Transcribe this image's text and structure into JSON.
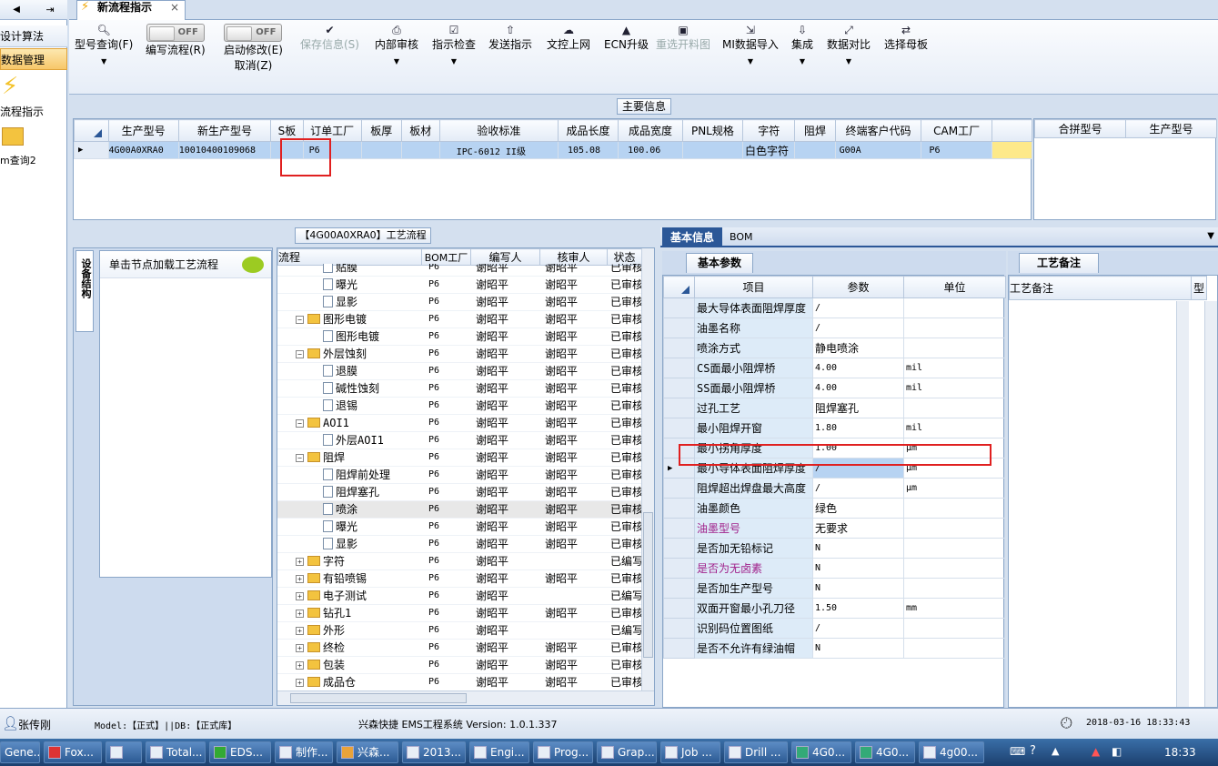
{
  "window": {
    "tab_title": "新流程指示",
    "tab_close": "×"
  },
  "left_nav": {
    "items": [
      {
        "label": "设计算法"
      },
      {
        "label": "数据管理",
        "selected": true
      },
      {
        "label": "流程指示"
      },
      {
        "label": "m查询2"
      }
    ]
  },
  "toolbar": {
    "buttons": [
      {
        "label": "型号查询(F)",
        "icon": "search-icon",
        "dropdown": true
      },
      {
        "label": "编写流程(R)",
        "toggle": "OFF"
      },
      {
        "label": "启动修改(E)",
        "toggle": "OFF",
        "sub": "取消(Z)"
      },
      {
        "label": "保存信息(S)",
        "icon": "check-icon",
        "disabled": true
      },
      {
        "label": "内部审核",
        "icon": "printer-icon",
        "dropdown": true
      },
      {
        "label": "指示检查",
        "icon": "checklist-icon",
        "dropdown": true
      },
      {
        "label": "发送指示",
        "icon": "upload-icon"
      },
      {
        "label": "文控上网",
        "icon": "cloud-icon"
      },
      {
        "label": "ECN升级",
        "icon": "ecn-icon"
      },
      {
        "label": "重选开料图",
        "icon": "image-icon",
        "disabled": true
      },
      {
        "label": "MI数据导入",
        "icon": "import-icon",
        "dropdown": true
      },
      {
        "label": "集成",
        "icon": "download-icon",
        "dropdown": true
      },
      {
        "label": "数据对比",
        "icon": "compare-icon",
        "dropdown": true
      },
      {
        "label": "选择母板",
        "icon": "shuffle-icon"
      }
    ]
  },
  "main_info": {
    "title": "主要信息",
    "columns": [
      "生产型号",
      "新生产型号",
      "S板",
      "订单工厂",
      "板厚",
      "板材",
      "验收标准",
      "成品长度",
      "成品宽度",
      "PNL规格",
      "字符",
      "阻焊",
      "终端客户代码",
      "CAM工厂"
    ],
    "rows": [
      [
        "4G00A0XRA0",
        "10010400109068",
        "",
        "P6",
        "",
        "",
        "IPC-6012 II级",
        "105.08",
        "100.06",
        "",
        "白色字符",
        "",
        "G00A",
        "P6"
      ]
    ],
    "side_columns": [
      "合拼型号",
      "生产型号"
    ]
  },
  "process": {
    "title": "【4G00A0XRA0】工艺流程",
    "side_tab": "设备结构",
    "hint": "单击节点加载工艺流程",
    "columns": [
      "流程",
      "BOM工厂",
      "编写人",
      "核审人",
      "状态"
    ],
    "rows": [
      {
        "name": "贴膜",
        "level": 2,
        "type": "doc",
        "bom": "P6",
        "writer": "谢昭平",
        "checker": "谢昭平",
        "status": "已审核"
      },
      {
        "name": "曝光",
        "level": 2,
        "type": "doc",
        "bom": "P6",
        "writer": "谢昭平",
        "checker": "谢昭平",
        "status": "已审核"
      },
      {
        "name": "显影",
        "level": 2,
        "type": "doc",
        "bom": "P6",
        "writer": "谢昭平",
        "checker": "谢昭平",
        "status": "已审核"
      },
      {
        "name": "图形电镀",
        "level": 1,
        "type": "folder",
        "expander": "−",
        "bom": "P6",
        "writer": "谢昭平",
        "checker": "谢昭平",
        "status": "已审核"
      },
      {
        "name": "图形电镀",
        "level": 2,
        "type": "doc",
        "bom": "P6",
        "writer": "谢昭平",
        "checker": "谢昭平",
        "status": "已审核"
      },
      {
        "name": "外层蚀刻",
        "level": 1,
        "type": "folder",
        "expander": "−",
        "bom": "P6",
        "writer": "谢昭平",
        "checker": "谢昭平",
        "status": "已审核"
      },
      {
        "name": "退膜",
        "level": 2,
        "type": "doc",
        "bom": "P6",
        "writer": "谢昭平",
        "checker": "谢昭平",
        "status": "已审核"
      },
      {
        "name": "碱性蚀刻",
        "level": 2,
        "type": "doc",
        "bom": "P6",
        "writer": "谢昭平",
        "checker": "谢昭平",
        "status": "已审核"
      },
      {
        "name": "退锡",
        "level": 2,
        "type": "doc",
        "bom": "P6",
        "writer": "谢昭平",
        "checker": "谢昭平",
        "status": "已审核"
      },
      {
        "name": "AOI1",
        "level": 1,
        "type": "folder",
        "expander": "−",
        "bom": "P6",
        "writer": "谢昭平",
        "checker": "谢昭平",
        "status": "已审核"
      },
      {
        "name": "外层AOI1",
        "level": 2,
        "type": "doc",
        "bom": "P6",
        "writer": "谢昭平",
        "checker": "谢昭平",
        "status": "已审核"
      },
      {
        "name": "阻焊",
        "level": 1,
        "type": "folder",
        "expander": "−",
        "bom": "P6",
        "writer": "谢昭平",
        "checker": "谢昭平",
        "status": "已审核"
      },
      {
        "name": "阻焊前处理",
        "level": 2,
        "type": "doc",
        "bom": "P6",
        "writer": "谢昭平",
        "checker": "谢昭平",
        "status": "已审核"
      },
      {
        "name": "阻焊塞孔",
        "level": 2,
        "type": "doc",
        "bom": "P6",
        "writer": "谢昭平",
        "checker": "谢昭平",
        "status": "已审核"
      },
      {
        "name": "喷涂",
        "level": 2,
        "type": "doc",
        "bom": "P6",
        "writer": "谢昭平",
        "checker": "谢昭平",
        "status": "已审核",
        "selected": true
      },
      {
        "name": "曝光",
        "level": 2,
        "type": "doc",
        "bom": "P6",
        "writer": "谢昭平",
        "checker": "谢昭平",
        "status": "已审核"
      },
      {
        "name": "显影",
        "level": 2,
        "type": "doc",
        "bom": "P6",
        "writer": "谢昭平",
        "checker": "谢昭平",
        "status": "已审核"
      },
      {
        "name": "字符",
        "level": 1,
        "type": "folder",
        "expander": "+",
        "bom": "P6",
        "writer": "谢昭平",
        "checker": "",
        "status": "已编写"
      },
      {
        "name": "有铅喷锡",
        "level": 1,
        "type": "folder",
        "expander": "+",
        "bom": "P6",
        "writer": "谢昭平",
        "checker": "谢昭平",
        "status": "已审核"
      },
      {
        "name": "电子测试",
        "level": 1,
        "type": "folder",
        "expander": "+",
        "bom": "P6",
        "writer": "谢昭平",
        "checker": "",
        "status": "已编写"
      },
      {
        "name": "钻孔1",
        "level": 1,
        "type": "folder",
        "expander": "+",
        "bom": "P6",
        "writer": "谢昭平",
        "checker": "谢昭平",
        "status": "已审核"
      },
      {
        "name": "外形",
        "level": 1,
        "type": "folder",
        "expander": "+",
        "bom": "P6",
        "writer": "谢昭平",
        "checker": "",
        "status": "已编写"
      },
      {
        "name": "终检",
        "level": 1,
        "type": "folder",
        "expander": "+",
        "bom": "P6",
        "writer": "谢昭平",
        "checker": "谢昭平",
        "status": "已审核"
      },
      {
        "name": "包装",
        "level": 1,
        "type": "folder",
        "expander": "+",
        "bom": "P6",
        "writer": "谢昭平",
        "checker": "谢昭平",
        "status": "已审核"
      },
      {
        "name": "成品仓",
        "level": 1,
        "type": "folder",
        "expander": "+",
        "bom": "P6",
        "writer": "谢昭平",
        "checker": "谢昭平",
        "status": "已审核"
      }
    ]
  },
  "basic_info": {
    "tabs": [
      "基本信息",
      "BOM"
    ],
    "subtab": "基本参数",
    "columns": [
      "项目",
      "参数",
      "单位"
    ],
    "rows": [
      {
        "item": "最大导体表面阻焊厚度",
        "value": "/",
        "unit": ""
      },
      {
        "item": "油墨名称",
        "value": "/",
        "unit": ""
      },
      {
        "item": "喷涂方式",
        "value": "静电喷涂",
        "unit": ""
      },
      {
        "item": "CS面最小阻焊桥",
        "value": "4.00",
        "unit": "mil"
      },
      {
        "item": "SS面最小阻焊桥",
        "value": "4.00",
        "unit": "mil"
      },
      {
        "item": "过孔工艺",
        "value": "阻焊塞孔",
        "unit": ""
      },
      {
        "item": "最小阻焊开窗",
        "value": "1.80",
        "unit": "mil"
      },
      {
        "item": "最小拐角厚度",
        "value": "1.00",
        "unit": "μm"
      },
      {
        "item": "最小导体表面阻焊厚度",
        "value": "/",
        "unit": "μm",
        "current": true
      },
      {
        "item": "阻焊超出焊盘最大高度",
        "value": "/",
        "unit": "μm"
      },
      {
        "item": "油墨颜色",
        "value": "绿色",
        "unit": ""
      },
      {
        "item": "油墨型号",
        "value": "无要求",
        "unit": "",
        "highlight": true
      },
      {
        "item": "是否加无铅标记",
        "value": "N",
        "unit": ""
      },
      {
        "item": "是否为无卤素",
        "value": "N",
        "unit": "",
        "highlight": true
      },
      {
        "item": "是否加生产型号",
        "value": "N",
        "unit": ""
      },
      {
        "item": "双面开窗最小孔刀径",
        "value": "1.50",
        "unit": "mm"
      },
      {
        "item": "识别码位置图纸",
        "value": "/",
        "unit": ""
      },
      {
        "item": "是否不允许有绿油帽",
        "value": "N",
        "unit": ""
      }
    ]
  },
  "remarks": {
    "tab": "工艺备注",
    "columns": [
      "工艺备注",
      "型"
    ]
  },
  "status_bar": {
    "user": "张传刚",
    "model": "Model:【正式】||DB:【正式库】",
    "app": "兴森快捷 EMS工程系统 Version: 1.0.1.337",
    "datetime": "2018-03-16 18:33:43"
  },
  "taskbar": {
    "items": [
      "Gene...",
      "Fox...",
      "",
      "Total...",
      "EDS...",
      "制作...",
      "兴森...",
      "2013...",
      "Engi...",
      "Prog...",
      "Grap...",
      "Job ...",
      "Drill ...",
      "4G0...",
      "4G0...",
      "4g00..."
    ],
    "clock": "18:33"
  },
  "colors": {
    "accent": "#2b5797",
    "selected_row": "#b7d3f2",
    "highlight_text": "#a0208a",
    "red_box": "#e02020"
  }
}
